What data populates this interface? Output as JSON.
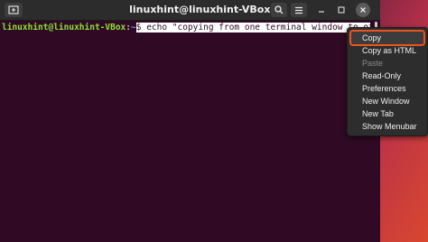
{
  "window": {
    "title": "linuxhint@linuxhint-VBox: ~"
  },
  "icons": {
    "new_tab": "new-tab-icon",
    "search": "search-icon",
    "menu": "hamburger-menu-icon",
    "minimize": "minimize-icon",
    "maximize": "maximize-icon",
    "close": "close-icon"
  },
  "terminal": {
    "prompt_user": "linuxhint@linuxhint-VBox",
    "prompt_sep": ":",
    "prompt_path": "~",
    "command": "$ echo \"copying from one terminal window to other\""
  },
  "context_menu": {
    "items": [
      {
        "label": "Copy",
        "state": "highlighted"
      },
      {
        "label": "Copy as HTML",
        "state": "enabled"
      },
      {
        "label": "Paste",
        "state": "disabled"
      },
      {
        "label": "Read-Only",
        "state": "enabled"
      },
      {
        "label": "Preferences",
        "state": "enabled"
      },
      {
        "label": "New Window",
        "state": "enabled"
      },
      {
        "label": "New Tab",
        "state": "enabled"
      },
      {
        "label": "Show Menubar",
        "state": "enabled"
      }
    ]
  },
  "colors": {
    "terminal_bg": "#300a24",
    "prompt_user": "#8ae234",
    "prompt_path": "#729fcf",
    "highlight_border": "#e95420"
  }
}
